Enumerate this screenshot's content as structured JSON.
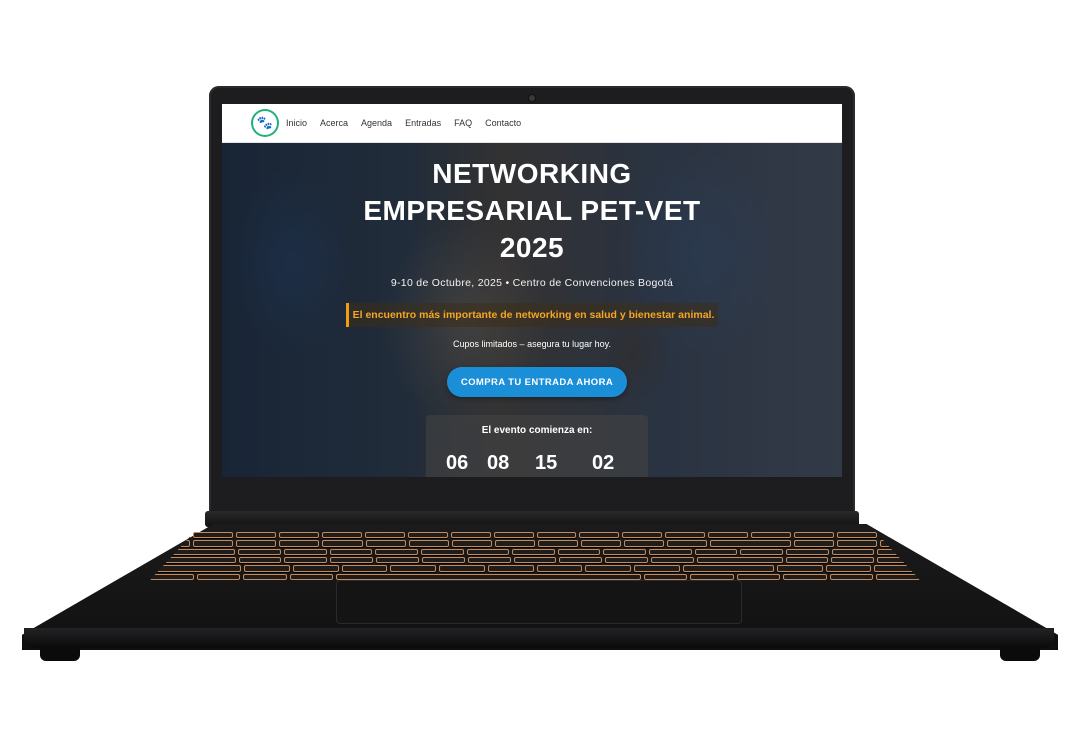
{
  "nav": {
    "logo_icon": "paw-icon",
    "links": [
      "Inicio",
      "Acerca",
      "Agenda",
      "Entradas",
      "FAQ",
      "Contacto"
    ]
  },
  "hero": {
    "title": "NETWORKING EMPRESARIAL PET-VET 2025",
    "subtitle": "9-10 de Octubre, 2025 • Centro de Convenciones Bogotá",
    "highlight": "El encuentro más importante de networking en salud y bienestar animal.",
    "limited": "Cupos limitados – asegura tu lugar hoy.",
    "cta_label": "COMPRA TU ENTRADA AHORA"
  },
  "countdown": {
    "label": "El evento comienza en:",
    "values": [
      "06",
      "08",
      "15",
      "02"
    ]
  },
  "colors": {
    "accent": "#1a8fd8",
    "highlight": "#f5a623",
    "logo_ring": "#20b07a"
  }
}
